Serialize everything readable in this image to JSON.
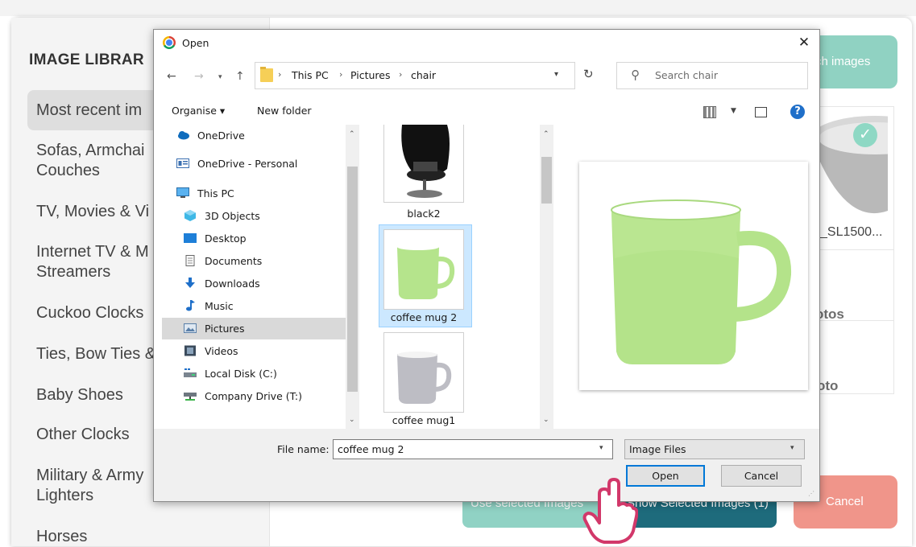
{
  "library": {
    "title": "IMAGE LIBRAR",
    "categories": [
      {
        "label": "Most recent im",
        "active": true
      },
      {
        "label": "Sofas, Armchai\nCouches"
      },
      {
        "label": "TV, Movies & Vi"
      },
      {
        "label": "Internet TV & M\nStreamers"
      },
      {
        "label": "Cuckoo Clocks"
      },
      {
        "label": "Ties, Bow Ties &"
      },
      {
        "label": "Baby Shoes"
      },
      {
        "label": "Other Clocks"
      },
      {
        "label": "Military & Army\nLighters"
      },
      {
        "label": "Horses"
      }
    ],
    "search_images_label": "ch images",
    "thumb_caption": "_SL1500...",
    "photos_label": "otos",
    "photo_label": "oto",
    "use_selected_label": "Use selected Images",
    "show_selected_label": "Show Selected Images (1)",
    "cancel_label": "Cancel",
    "accent_teal": "#90d2c2",
    "accent_dark": "#1e6b7c",
    "accent_red": "#f0958a"
  },
  "dialog": {
    "title": "Open",
    "close_icon": "close-icon",
    "breadcrumbs": [
      "This PC",
      "Pictures",
      "chair"
    ],
    "search_placeholder": "Search chair",
    "toolbar": {
      "organise_label": "Organise ▾",
      "new_folder_label": "New folder"
    },
    "nav": [
      {
        "label": "OneDrive",
        "icon": "cloud-icon"
      },
      {
        "label": "OneDrive - Personal",
        "icon": "onedrive-personal-icon"
      },
      {
        "label": "This PC",
        "icon": "computer-icon"
      },
      {
        "label": "3D Objects",
        "icon": "cube-icon"
      },
      {
        "label": "Desktop",
        "icon": "desktop-icon"
      },
      {
        "label": "Documents",
        "icon": "document-icon"
      },
      {
        "label": "Downloads",
        "icon": "download-icon"
      },
      {
        "label": "Music",
        "icon": "music-icon"
      },
      {
        "label": "Pictures",
        "icon": "pictures-icon",
        "selected": true
      },
      {
        "label": "Videos",
        "icon": "video-icon"
      },
      {
        "label": "Local Disk (C:)",
        "icon": "disk-icon"
      },
      {
        "label": "Company Drive (T:)",
        "icon": "network-drive-icon"
      }
    ],
    "files": [
      {
        "name": "black2"
      },
      {
        "name": "coffee mug 2",
        "selected": true
      },
      {
        "name": "coffee mug1"
      }
    ],
    "file_name_label": "File name:",
    "file_name_value": "coffee mug 2",
    "file_type_value": "Image Files",
    "open_label": "Open",
    "cancel_label": "Cancel"
  }
}
